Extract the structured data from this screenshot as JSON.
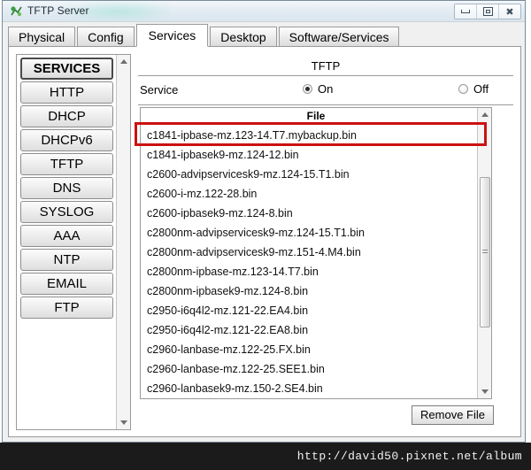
{
  "window": {
    "title": "TFTP Server",
    "icon": "app-icon",
    "controls": [
      {
        "name": "minimize-button",
        "glyph": "minimize"
      },
      {
        "name": "restore-button",
        "glyph": "restore"
      },
      {
        "name": "close-button",
        "glyph": "✖"
      }
    ]
  },
  "tabs": [
    {
      "label": "Physical",
      "active": false
    },
    {
      "label": "Config",
      "active": false
    },
    {
      "label": "Services",
      "active": true
    },
    {
      "label": "Desktop",
      "active": false
    },
    {
      "label": "Software/Services",
      "active": false
    }
  ],
  "sidebar": {
    "header": "SERVICES",
    "items": [
      {
        "label": "HTTP"
      },
      {
        "label": "DHCP"
      },
      {
        "label": "DHCPv6"
      },
      {
        "label": "TFTP"
      },
      {
        "label": "DNS"
      },
      {
        "label": "SYSLOG"
      },
      {
        "label": "AAA"
      },
      {
        "label": "NTP"
      },
      {
        "label": "EMAIL"
      },
      {
        "label": "FTP"
      }
    ]
  },
  "main": {
    "panel_title": "TFTP",
    "service": {
      "label": "Service",
      "on_label": "On",
      "off_label": "Off",
      "selected": "On"
    },
    "file_table": {
      "column_header": "File",
      "highlighted_row_index": 0,
      "highlight_color": "#cc1111",
      "rows": [
        "c1841-ipbase-mz.123-14.T7.mybackup.bin",
        "c1841-ipbasek9-mz.124-12.bin",
        "c2600-advipservicesk9-mz.124-15.T1.bin",
        "c2600-i-mz.122-28.bin",
        "c2600-ipbasek9-mz.124-8.bin",
        "c2800nm-advipservicesk9-mz.124-15.T1.bin",
        "c2800nm-advipservicesk9-mz.151-4.M4.bin",
        "c2800nm-ipbase-mz.123-14.T7.bin",
        "c2800nm-ipbasek9-mz.124-8.bin",
        "c2950-i6q4l2-mz.121-22.EA4.bin",
        "c2950-i6q4l2-mz.121-22.EA8.bin",
        "c2960-lanbase-mz.122-25.FX.bin",
        "c2960-lanbase-mz.122-25.SEE1.bin",
        "c2960-lanbasek9-mz.150-2.SE4.bin"
      ]
    },
    "remove_button": "Remove File"
  },
  "watermark": {
    "text": "http://david50.pixnet.net/album"
  }
}
